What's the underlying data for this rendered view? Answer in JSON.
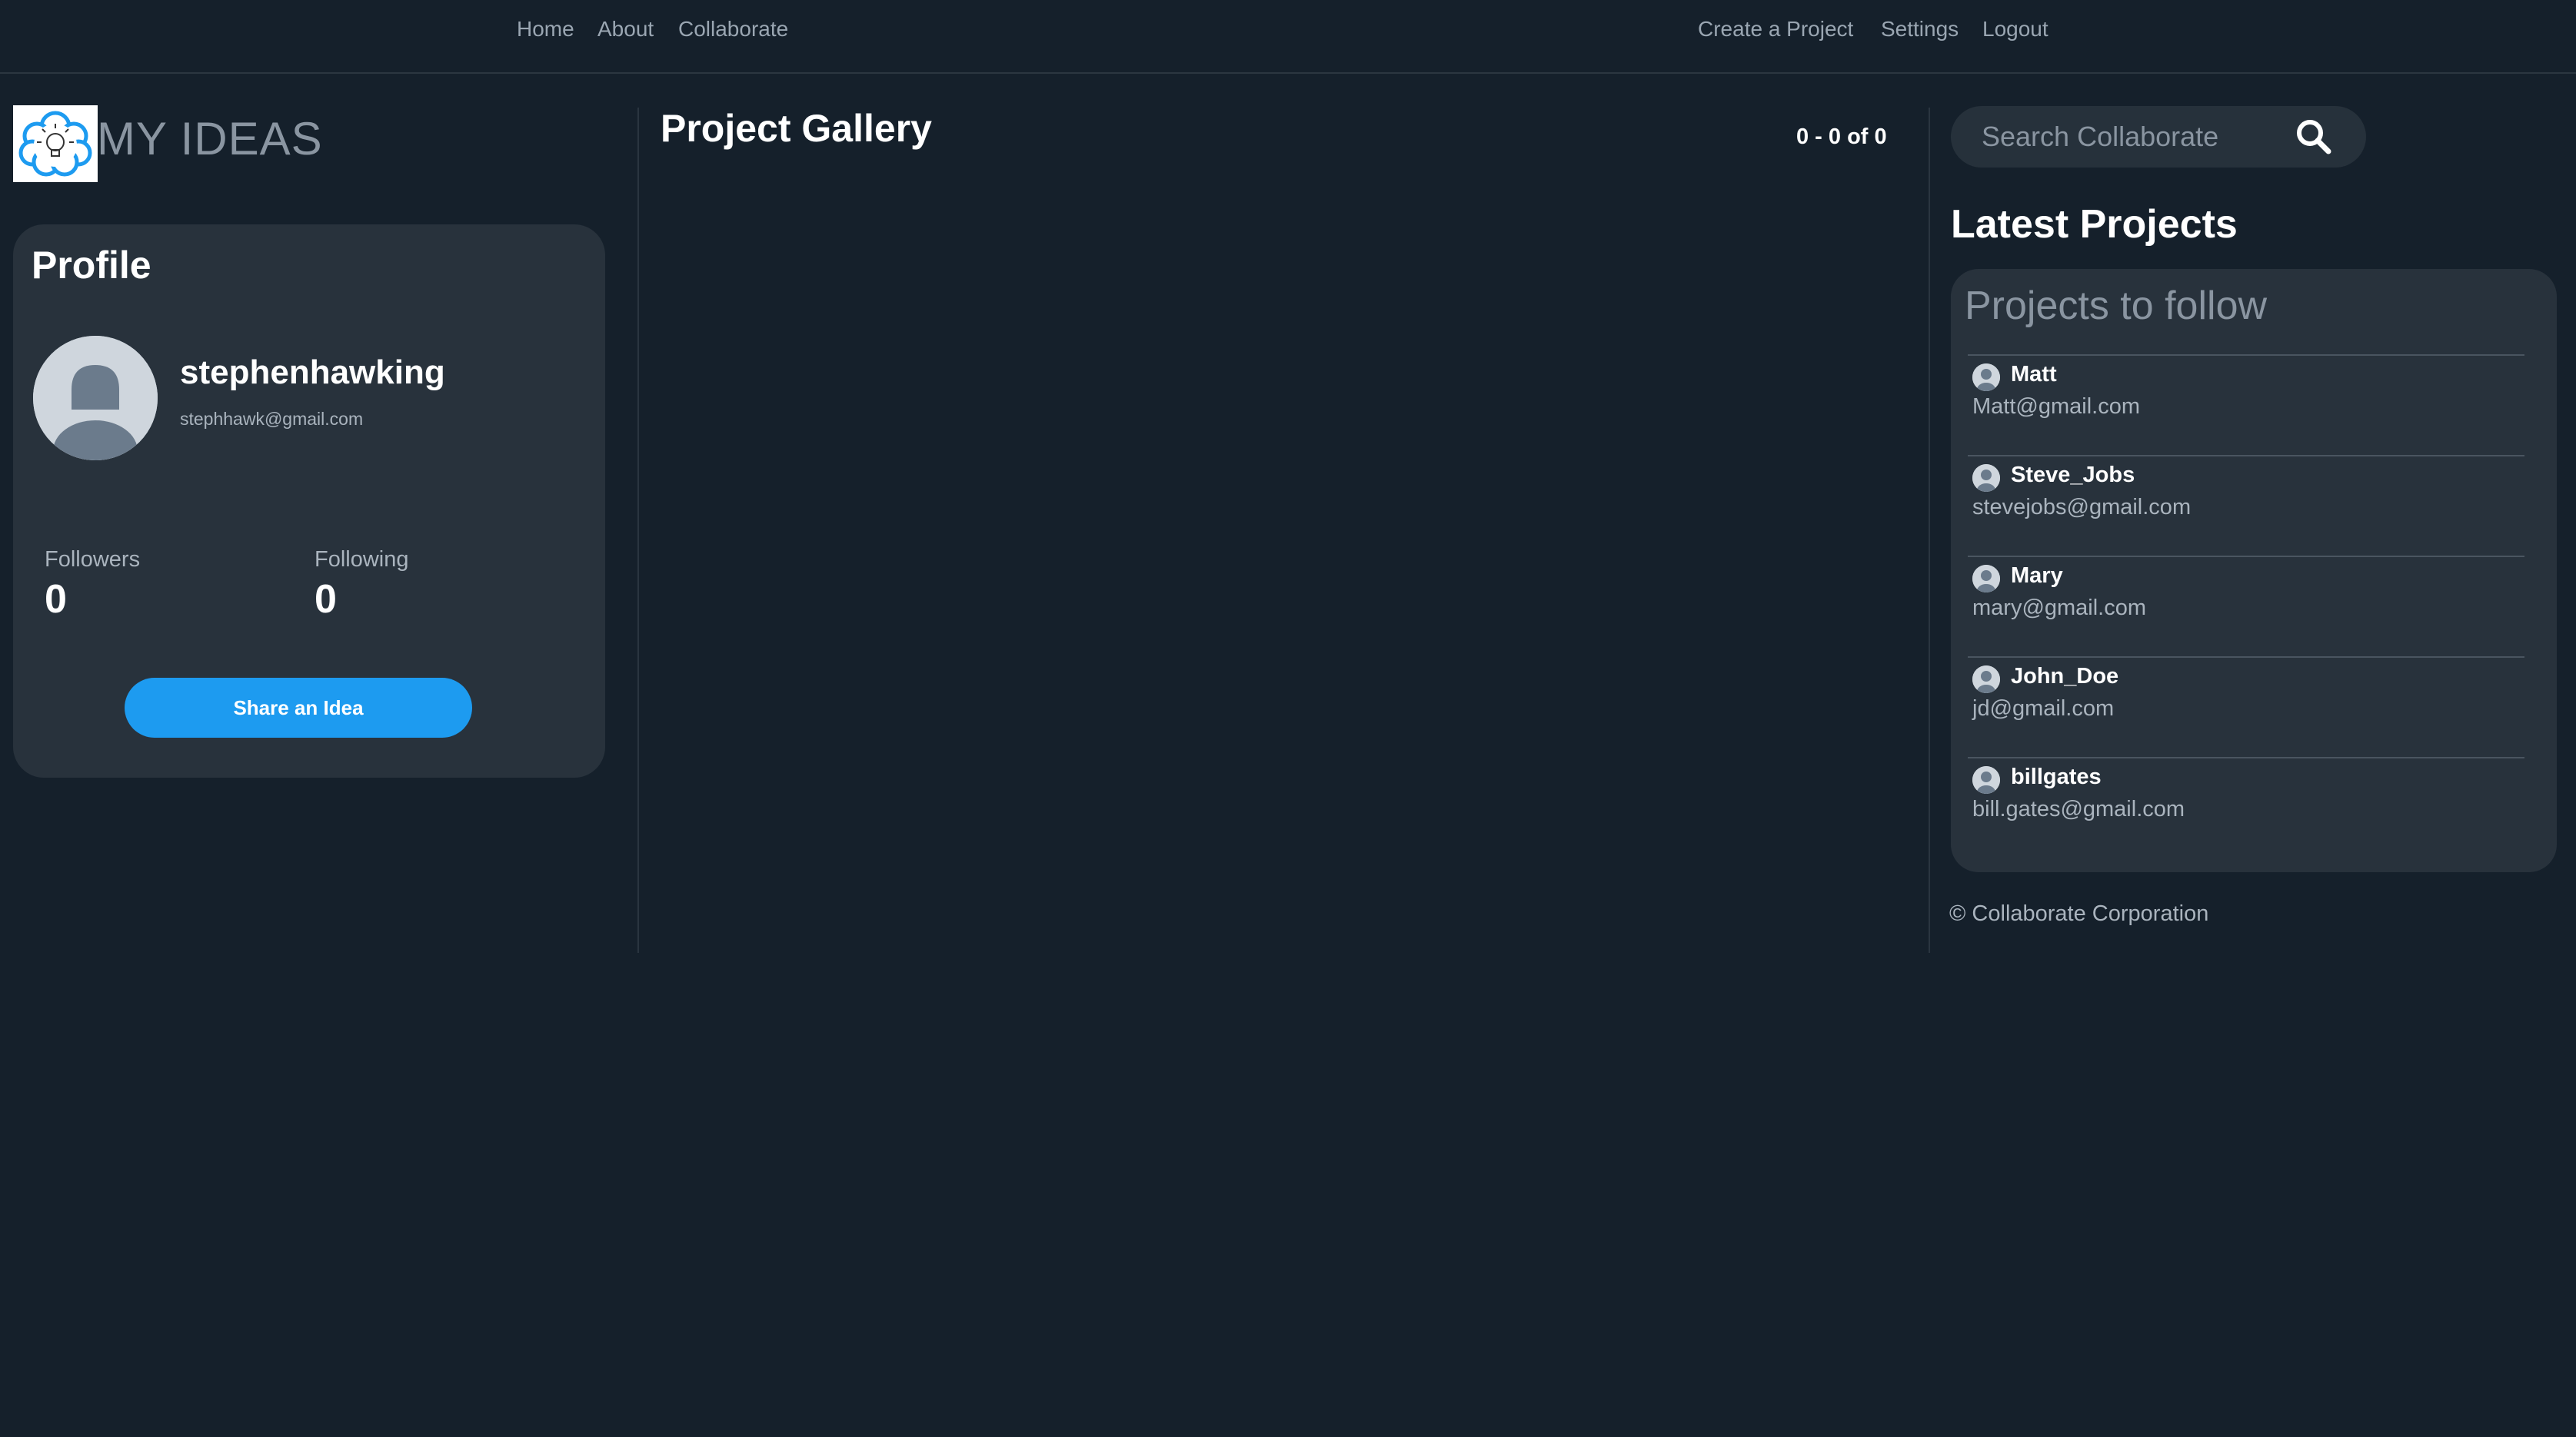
{
  "nav": {
    "left": [
      "Home",
      "About",
      "Collaborate"
    ],
    "right": [
      "Create a Project",
      "Settings",
      "Logout"
    ]
  },
  "brand": {
    "name": "MY IDEAS",
    "logo_icon": "lightbulb-cloud-icon"
  },
  "profile": {
    "title": "Profile",
    "username": "stephenhawking",
    "email": "stephhawk@gmail.com",
    "followers_label": "Followers",
    "followers": "0",
    "following_label": "Following",
    "following": "0",
    "share_button": "Share an Idea"
  },
  "gallery": {
    "title": "Project Gallery",
    "pager": "0 - 0 of 0"
  },
  "search": {
    "placeholder": "Search Collaborate"
  },
  "latest": {
    "title": "Latest Projects",
    "card_title": "Projects to follow",
    "items": [
      {
        "name": "Matt",
        "email": "Matt@gmail.com"
      },
      {
        "name": "Steve_Jobs",
        "email": "stevejobs@gmail.com"
      },
      {
        "name": "Mary",
        "email": "mary@gmail.com"
      },
      {
        "name": "John_Doe",
        "email": "jd@gmail.com"
      },
      {
        "name": "billgates",
        "email": "bill.gates@gmail.com"
      }
    ]
  },
  "footer": "© Collaborate Corporation",
  "colors": {
    "background": "#15202b",
    "card": "#28323c",
    "accent": "#1d9bf0",
    "muted_text": "#8a95a1"
  }
}
